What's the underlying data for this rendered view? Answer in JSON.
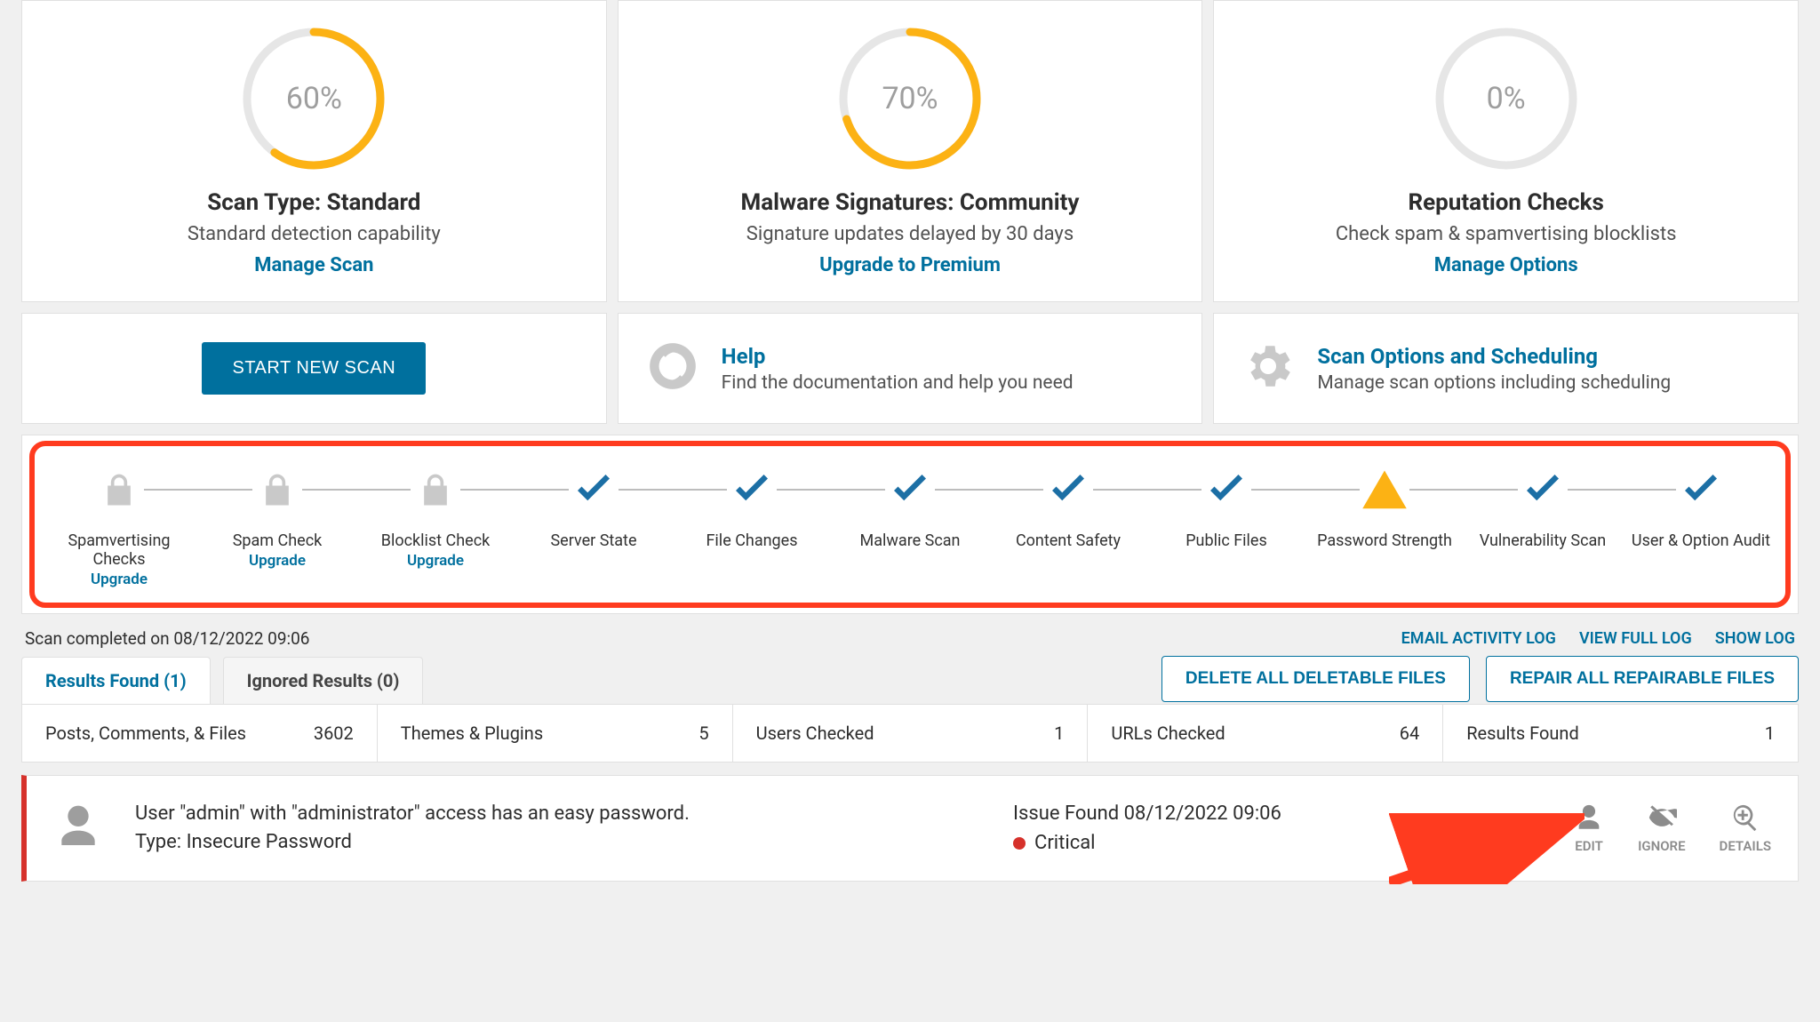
{
  "cards": [
    {
      "percent": 60,
      "title": "Scan Type: Standard",
      "sub": "Standard detection capability",
      "link": "Manage Scan"
    },
    {
      "percent": 70,
      "title": "Malware Signatures: Community",
      "sub": "Signature updates delayed by 30 days",
      "link": "Upgrade to Premium"
    },
    {
      "percent": 0,
      "title": "Reputation Checks",
      "sub": "Check spam & spamvertising blocklists",
      "link": "Manage Options"
    }
  ],
  "tools": {
    "start_scan": "START NEW SCAN",
    "help": {
      "title": "Help",
      "sub": "Find the documentation and help you need"
    },
    "options": {
      "title": "Scan Options and Scheduling",
      "sub": "Manage scan options including scheduling"
    }
  },
  "stages": [
    {
      "label": "Spamvertising Checks",
      "icon": "lock",
      "upgrade": "Upgrade"
    },
    {
      "label": "Spam Check",
      "icon": "lock",
      "upgrade": "Upgrade"
    },
    {
      "label": "Blocklist Check",
      "icon": "lock",
      "upgrade": "Upgrade"
    },
    {
      "label": "Server State",
      "icon": "check"
    },
    {
      "label": "File Changes",
      "icon": "check"
    },
    {
      "label": "Malware Scan",
      "icon": "check"
    },
    {
      "label": "Content Safety",
      "icon": "check"
    },
    {
      "label": "Public Files",
      "icon": "check"
    },
    {
      "label": "Password Strength",
      "icon": "warn"
    },
    {
      "label": "Vulnerability Scan",
      "icon": "check"
    },
    {
      "label": "User & Option Audit",
      "icon": "check"
    }
  ],
  "meta": {
    "completed": "Scan completed on 08/12/2022 09:06",
    "links": {
      "email": "EMAIL ACTIVITY LOG",
      "full": "VIEW FULL LOG",
      "show": "SHOW LOG"
    }
  },
  "tabs": {
    "results": "Results Found (1)",
    "ignored": "Ignored Results (0)"
  },
  "bulk": {
    "delete": "DELETE ALL DELETABLE FILES",
    "repair": "REPAIR ALL REPAIRABLE FILES"
  },
  "stats": [
    {
      "label": "Posts, Comments, & Files",
      "value": "3602"
    },
    {
      "label": "Themes & Plugins",
      "value": "5"
    },
    {
      "label": "Users Checked",
      "value": "1"
    },
    {
      "label": "URLs Checked",
      "value": "64"
    },
    {
      "label": "Results Found",
      "value": "1"
    }
  ],
  "result": {
    "message_line1": "User \"admin\" with \"administrator\" access has an easy password.",
    "message_line2": "Type: Insecure Password",
    "found_label": "Issue Found 08/12/2022 09:06",
    "severity": "Critical",
    "actions": {
      "edit": "EDIT",
      "ignore": "IGNORE",
      "details": "DETAILS"
    }
  }
}
